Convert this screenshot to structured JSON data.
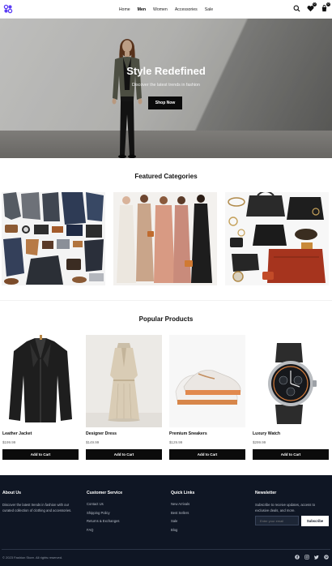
{
  "header": {
    "logo_alt": "logo",
    "nav": [
      {
        "label": "Home",
        "active": false
      },
      {
        "label": "Men",
        "active": true
      },
      {
        "label": "Women",
        "active": false
      },
      {
        "label": "Accessories",
        "active": false
      },
      {
        "label": "Sale",
        "active": false
      }
    ],
    "icons": [
      "search-icon",
      "heart-icon",
      "cart-icon"
    ],
    "wishlist_count": "0",
    "cart_count": "0"
  },
  "hero": {
    "title": "Style Redefined",
    "subtitle": "Discover the latest trends in fashion",
    "cta": "Shop Now"
  },
  "categories": {
    "title": "Featured Categories",
    "items": [
      {
        "image": "mens-flatlay"
      },
      {
        "image": "women-dresses"
      },
      {
        "image": "accessories-bags"
      }
    ]
  },
  "products": {
    "title": "Popular Products",
    "items": [
      {
        "name": "Leather Jacket",
        "price": "$199.99",
        "button": "Add to Cart"
      },
      {
        "name": "Designer Dress",
        "price": "$149.99",
        "button": "Add to Cart"
      },
      {
        "name": "Premium Sneakers",
        "price": "$129.99",
        "button": "Add to Cart"
      },
      {
        "name": "Luxury Watch",
        "price": "$299.99",
        "button": "Add to Cart"
      }
    ]
  },
  "footer": {
    "about": {
      "title": "About Us",
      "text": "Discover the latest trends in fashion with our curated collection of clothing and accessories."
    },
    "service": {
      "title": "Customer Service",
      "links": [
        "Contact Us",
        "Shipping Policy",
        "Returns & Exchanges",
        "FAQ"
      ]
    },
    "quick": {
      "title": "Quick Links",
      "links": [
        "New Arrivals",
        "Best Sellers",
        "Sale",
        "Blog"
      ]
    },
    "newsletter": {
      "title": "Newsletter",
      "text": "Subscribe to receive updates, access to exclusive deals, and more.",
      "placeholder": "Enter your email",
      "button": "Subscribe"
    },
    "copyright": "© 2023 Fashion Store. All rights reserved.",
    "social": [
      "facebook-icon",
      "instagram-icon",
      "twitter-icon",
      "pinterest-icon"
    ]
  },
  "colors": {
    "accent": "#5b3df5",
    "dark": "#0b0b0b",
    "footer_bg": "#0f1624"
  }
}
